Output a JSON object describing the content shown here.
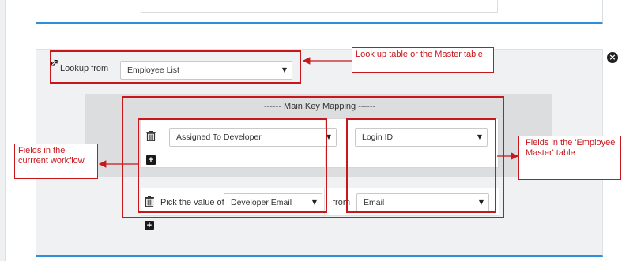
{
  "lookup": {
    "label": "Lookup from",
    "selected": "Employee List"
  },
  "mapping": {
    "header": "------ Main Key Mapping ------",
    "row1": {
      "source_field": "Assigned To Developer",
      "target_field": "Login ID"
    },
    "row2": {
      "pick_label": "Pick the value of",
      "source_field": "Developer Email",
      "from_label": "from",
      "target_field": "Email"
    }
  },
  "icons": {
    "close": "close-icon",
    "trash": "trash-icon",
    "plus": "plus-icon",
    "caret": "caret-down-icon",
    "cursor": "resize-cursor-icon"
  },
  "annotations": {
    "lookup_callout": "Look up table or the Master table",
    "current_workflow_callout": "Fields in the currrent workflow",
    "employee_master_callout": "Fields in the 'Employee Master' table"
  },
  "colors": {
    "accent": "#2f8fd8",
    "annotation_red": "#c8161d"
  }
}
